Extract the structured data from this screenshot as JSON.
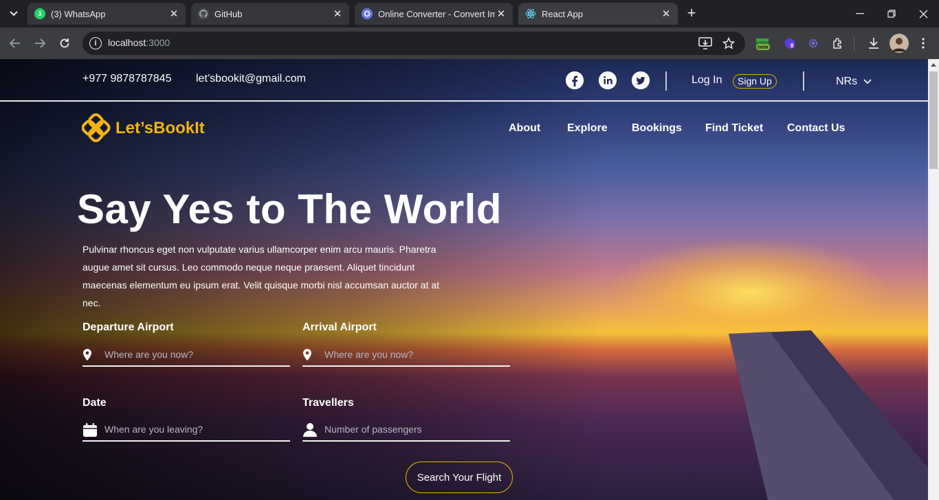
{
  "browser": {
    "tabs": [
      {
        "label": "(3) WhatsApp",
        "favicon": "whatsapp-icon"
      },
      {
        "label": "GitHub",
        "favicon": "github-icon"
      },
      {
        "label": "Online Converter - Convert Ima",
        "favicon": "converter-icon"
      },
      {
        "label": "React App",
        "favicon": "react-icon"
      }
    ],
    "whatsapp_count": "3",
    "url_host": "localhost",
    "url_port": ":3000",
    "ext_new_badge": "new",
    "ext_count_badge": "8"
  },
  "topbar": {
    "phone": "+977 9878787845",
    "email": "let’sbookit@gmail.com",
    "login": "Log In",
    "signup": "Sign Up",
    "currency": "NRs"
  },
  "header": {
    "brand": "Let’sBookIt",
    "nav": [
      "About",
      "Explore",
      "Bookings",
      "Find Ticket",
      "Contact Us"
    ]
  },
  "hero": {
    "title": "Say Yes to The World",
    "lead": "Pulvinar rhoncus eget non vulputate varius ullamcorper enim arcu mauris. Pharetra augue amet sit cursus. Leo commodo neque neque praesent. Aliquet tincidunt maecenas elementum eu ipsum erat. Velit quisque morbi nisl accumsan auctor at at nec."
  },
  "form": {
    "departure": {
      "label": "Departure Airport",
      "placeholder": "Where are you now?"
    },
    "arrival": {
      "label": "Arrival Airport",
      "placeholder": "Where are you now?"
    },
    "date": {
      "label": "Date",
      "placeholder": "When are you leaving?"
    },
    "travellers": {
      "label": "Travellers",
      "placeholder": "Number of passengers"
    },
    "submit": "Search Your Flight"
  },
  "colors": {
    "accent": "#f2b316",
    "button_border": "#e0b500"
  }
}
